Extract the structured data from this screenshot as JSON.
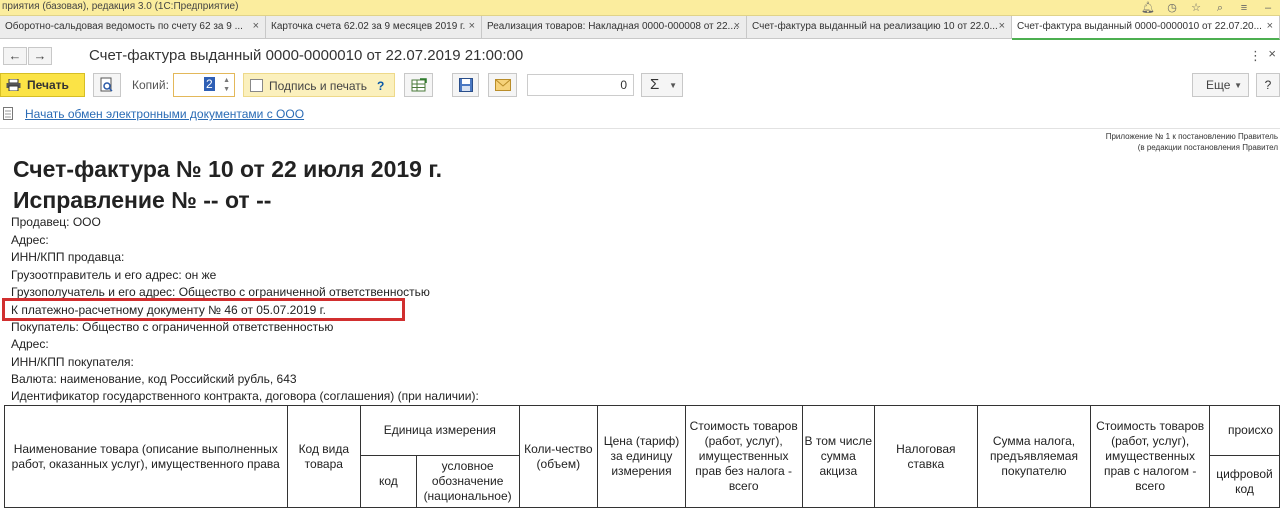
{
  "titlebar": {
    "app_title": "приятия (базовая), редакция 3.0  (1С:Предприятие)",
    "icons": [
      "bell-icon",
      "history-icon",
      "star-icon",
      "search-icon",
      "menu-icon",
      "minimize-icon"
    ]
  },
  "tabs": [
    {
      "label": "Оборотно-сальдовая ведомость по счету 62 за 9 ..."
    },
    {
      "label": "Карточка счета 62.02 за 9 месяцев 2019 г."
    },
    {
      "label": "Реализация товаров: Накладная 0000-000008 от 22...."
    },
    {
      "label": "Счет-фактура выданный на реализацию 10 от 22.0..."
    },
    {
      "label": "Счет-фактура выданный 0000-0000010 от 22.07.20..."
    }
  ],
  "nav": {
    "back": "←",
    "forward": "→",
    "title": "Счет-фактура выданный 0000-0000010 от 22.07.2019 21:00:00",
    "kebab": "⋮",
    "close": "×"
  },
  "toolbar": {
    "print_label": "Печать",
    "copies_label": "Копий:",
    "copies_value": "2",
    "sign_print_label": "Подпись и печать",
    "sign_help": "?",
    "sum_value": "0",
    "sigma_label": "Σ",
    "more_label": "Еще",
    "help_label": "?"
  },
  "edo_link": "Начать обмен электронными документами с ООО",
  "document": {
    "appendix_line1": "Приложение № 1 к постановлению Правитель",
    "appendix_line2": "(в редакции постановления Правител",
    "title": "Счет-фактура № 10 от 22 июля 2019 г.",
    "correction": "Исправление № -- от --",
    "lines": [
      "Продавец: ООО",
      "Адрес:",
      "ИНН/КПП продавца:",
      "Грузоотправитель и его адрес: он же",
      "Грузополучатель и его адрес: Общество с ограниченной ответственностью",
      "К платежно-расчетному документу № 46 от 05.07.2019 г.",
      "Покупатель: Общество с ограниченной ответственностью",
      "Адрес:",
      "ИНН/КПП покупателя:",
      "Валюта: наименование, код Российский рубль, 643",
      "Идентификатор государственного контракта, договора (соглашения) (при наличии):"
    ],
    "table_headers": {
      "name": "Наименование товара (описание выполненных работ, оказанных услуг), имущественного права",
      "kind_code": "Код вида товара",
      "unit": "Единица измерения",
      "unit_code": "код",
      "unit_symbol": "условное обозначение (национальное)",
      "qty": "Коли-чество (объем)",
      "price": "Цена (тариф) за единицу измерения",
      "cost_no_tax": "Стоимость товаров (работ, услуг), имущественных прав без налога - всего",
      "excise": "В том числе сумма акциза",
      "tax_rate": "Налоговая ставка",
      "tax_sum": "Сумма налога, предъявляемая покупателю",
      "cost_with_tax": "Стоимость товаров (работ, услуг), имущественных прав с налогом - всего",
      "origin": "происхо",
      "digital_code": "цифровой код"
    }
  },
  "colors": {
    "titlebar_bg": "#fbed9e",
    "print_button": "#fbe346",
    "active_tab_underline": "#4caf50",
    "link": "#2a6bb5",
    "highlight_border": "#d12f2f"
  }
}
